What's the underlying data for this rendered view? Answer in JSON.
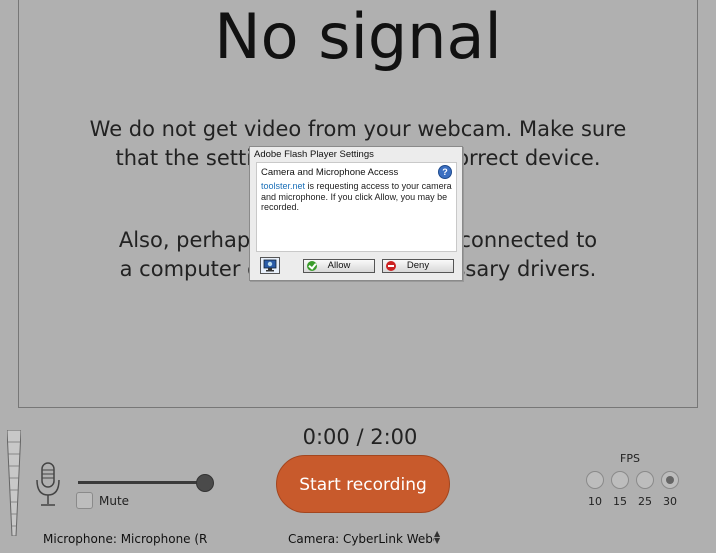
{
  "video": {
    "title": "No signal",
    "message_1_line_1": "We do not get video from your webcam. Make sure",
    "message_1_line_2": "that the settings are set to the correct device.",
    "message_2_line_1": "Also, perhaps the camera is not connected to",
    "message_2_line_2": "a computer or missing the necessary drivers."
  },
  "flash_dialog": {
    "window_title": "Adobe Flash Player Settings",
    "heading": "Camera and Microphone Access",
    "help_icon": "?",
    "site_link": "toolster.net",
    "body_text": " is requesting access to your camera and microphone. If you click Allow, you may be recorded.",
    "allow_label": "Allow",
    "deny_label": "Deny",
    "camera_icon": "camera-settings-icon"
  },
  "controls": {
    "mute_label": "Mute",
    "microphone_select": "Microphone: Microphone (Rea",
    "timer": "0:00 / 2:00",
    "record_label": "Start recording",
    "camera_select": "Camera: CyberLink Webcam",
    "volume_level": 1.0,
    "fps": {
      "label": "FPS",
      "options": [
        "10",
        "15",
        "25",
        "30"
      ],
      "selected": "30"
    }
  },
  "colors": {
    "background": "#b0b0b0",
    "record_button": "#c85a2c"
  }
}
